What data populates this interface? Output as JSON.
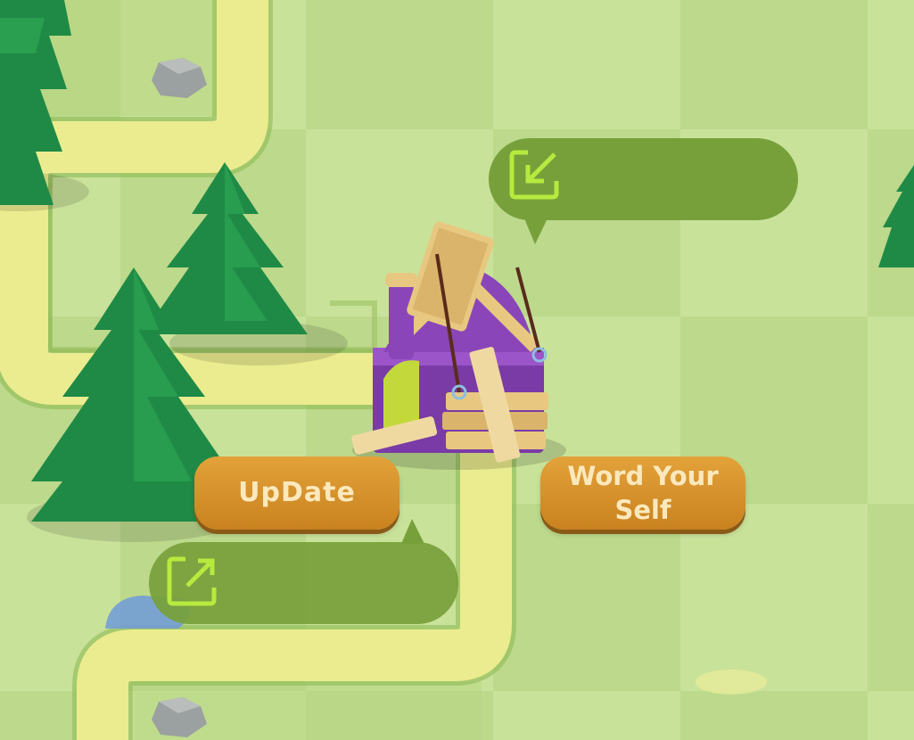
{
  "buttons": {
    "update_label": "UpDate",
    "word_your_self_label": "Word Your Self"
  },
  "bubbles": {
    "top": {
      "icon": "import-arrow-icon"
    },
    "bottom": {
      "icon": "export-arrow-icon"
    }
  },
  "colors": {
    "grass_light": "#c9e29a",
    "grass_dark": "#bad88a",
    "path": "#ebec8f",
    "bubble": "#77a03a",
    "bubble_icon": "#b7ea3e",
    "button": "#d8952e",
    "button_text": "#fbe9bd",
    "tree": "#1f8a45",
    "building_purple": "#8a46b8",
    "wood": "#e8c880"
  }
}
